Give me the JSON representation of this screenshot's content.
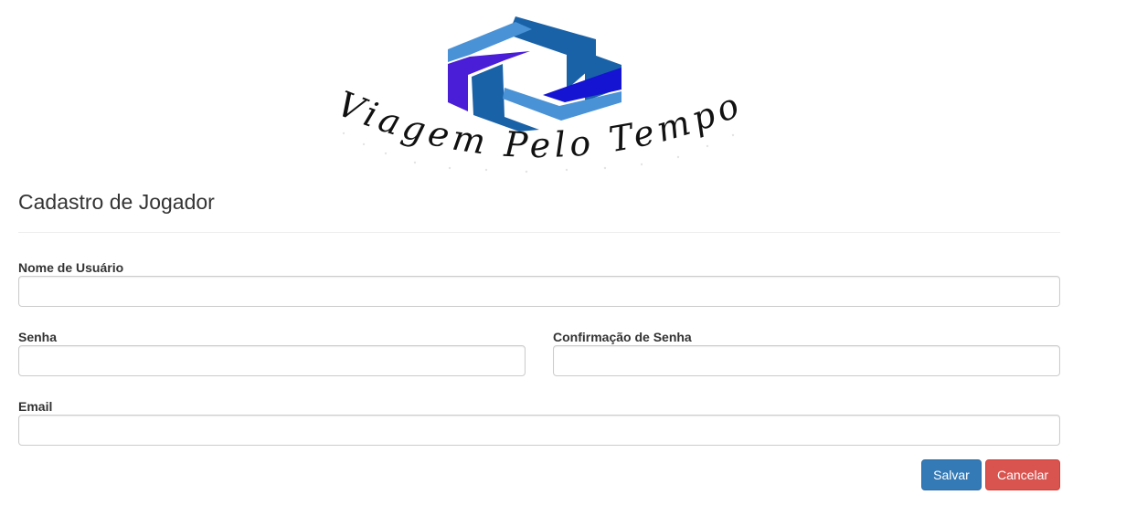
{
  "logo": {
    "text": "Viagem Pelo Tempo",
    "colors": {
      "dark_blue": "#1a62a8",
      "light_blue": "#4a92d6",
      "purple": "#4a1ed6",
      "royal_blue": "#1414d2",
      "text": "#111111"
    }
  },
  "form": {
    "title": "Cadastro de Jogador",
    "username": {
      "label": "Nome de Usuário",
      "value": "",
      "placeholder": ""
    },
    "password": {
      "label": "Senha",
      "value": "",
      "placeholder": ""
    },
    "password_confirm": {
      "label": "Confirmação de Senha",
      "value": "",
      "placeholder": ""
    },
    "email": {
      "label": "Email",
      "value": "",
      "placeholder": ""
    },
    "save_label": "Salvar",
    "cancel_label": "Cancelar"
  },
  "colors": {
    "primary": "#337ab7",
    "danger": "#d9534f",
    "input_border": "#cccccc",
    "divider": "#eeeeee"
  }
}
